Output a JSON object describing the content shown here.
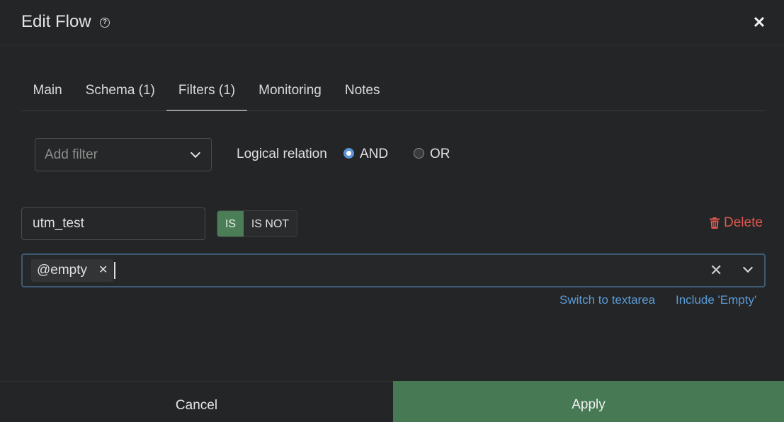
{
  "dialog": {
    "title": "Edit Flow",
    "help_icon": "question-circle-icon",
    "close_icon": "close-icon"
  },
  "tabs": [
    {
      "label": "Main",
      "active": false
    },
    {
      "label": "Schema (1)",
      "active": false
    },
    {
      "label": "Filters (1)",
      "active": true
    },
    {
      "label": "Monitoring",
      "active": false
    },
    {
      "label": "Notes",
      "active": false
    }
  ],
  "filters": {
    "add_filter_placeholder": "Add filter",
    "logical_relation_label": "Logical relation",
    "relation_options": [
      "AND",
      "OR"
    ],
    "relation_selected": "AND",
    "items": [
      {
        "field": "utm_test",
        "operator_options": [
          "IS",
          "IS NOT"
        ],
        "operator_selected": "IS",
        "delete_label": "Delete",
        "values": [
          "@empty"
        ],
        "switch_textarea_label": "Switch to textarea",
        "include_empty_label": "Include 'Empty'"
      }
    ]
  },
  "footer": {
    "cancel_label": "Cancel",
    "apply_label": "Apply"
  },
  "colors": {
    "background": "#242526",
    "accent_green": "#477954",
    "link_blue": "#5b9bd8",
    "danger_red": "#e0574f"
  }
}
